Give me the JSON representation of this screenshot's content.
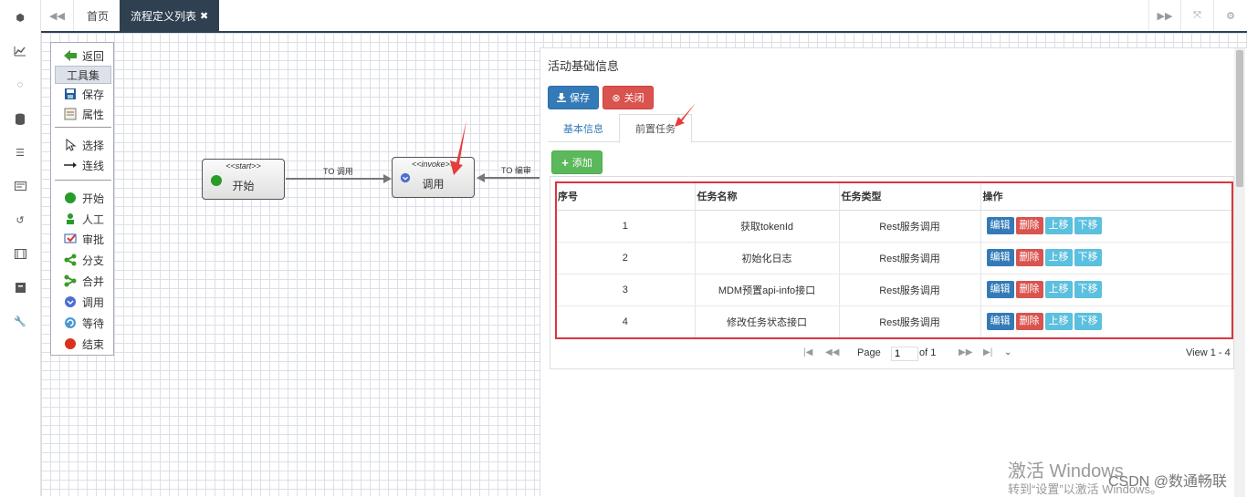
{
  "topbar": {
    "home_tab": "首页",
    "active_tab": "流程定义列表",
    "close_glyph": "✖"
  },
  "palette": {
    "items": [
      {
        "label": "返回",
        "icon": "back-arrow-icon"
      },
      {
        "label": "工具集",
        "icon": ""
      },
      {
        "label": "保存",
        "icon": "save-icon"
      },
      {
        "label": "属性",
        "icon": "properties-icon"
      },
      {
        "label": "选择",
        "icon": "select-cursor-icon"
      },
      {
        "label": "连线",
        "icon": "connector-arrow-icon"
      },
      {
        "label": "开始",
        "icon": "start-circle-icon"
      },
      {
        "label": "人工",
        "icon": "person-icon"
      },
      {
        "label": "审批",
        "icon": "approve-icon"
      },
      {
        "label": "分支",
        "icon": "branch-icon"
      },
      {
        "label": "合并",
        "icon": "merge-icon"
      },
      {
        "label": "调用",
        "icon": "invoke-icon"
      },
      {
        "label": "等待",
        "icon": "wait-icon"
      },
      {
        "label": "结束",
        "icon": "end-circle-icon"
      }
    ]
  },
  "flow": {
    "start_node": {
      "stereotype": "<<start>>",
      "label": "开始"
    },
    "invoke_node": {
      "stereotype": "<<invoke>>",
      "label": "调用"
    },
    "edge1": "TO 调用",
    "edge2": "TO 编审"
  },
  "panel": {
    "title": "活动基础信息",
    "save_label": "保存",
    "close_label": "关闭",
    "tab_basic": "基本信息",
    "tab_pre": "前置任务",
    "add_label": "添加",
    "columns": [
      "序号",
      "任务名称",
      "任务类型",
      "操作"
    ],
    "rows": [
      {
        "no": "1",
        "name": "获取tokenId",
        "type": "Rest服务调用"
      },
      {
        "no": "2",
        "name": "初始化日志",
        "type": "Rest服务调用"
      },
      {
        "no": "3",
        "name": "MDM预置api-info接口",
        "type": "Rest服务调用"
      },
      {
        "no": "4",
        "name": "修改任务状态接口",
        "type": "Rest服务调用"
      }
    ],
    "ops": {
      "edit": "编辑",
      "delete": "删除",
      "up": "上移",
      "down": "下移"
    },
    "pager": {
      "page_label": "Page",
      "page_value": "1",
      "of_label": "of 1",
      "view": "View 1 - 4"
    }
  },
  "watermark": {
    "line1": "激活 Windows",
    "line2": "转到“设置”以激活 Windows。",
    "csdn": "CSDN @数通畅联"
  },
  "colors": {
    "primary": "#337ab7",
    "danger": "#d9534f",
    "success": "#5cb85c",
    "info": "#5bc0de",
    "highlight": "#d9363e"
  }
}
